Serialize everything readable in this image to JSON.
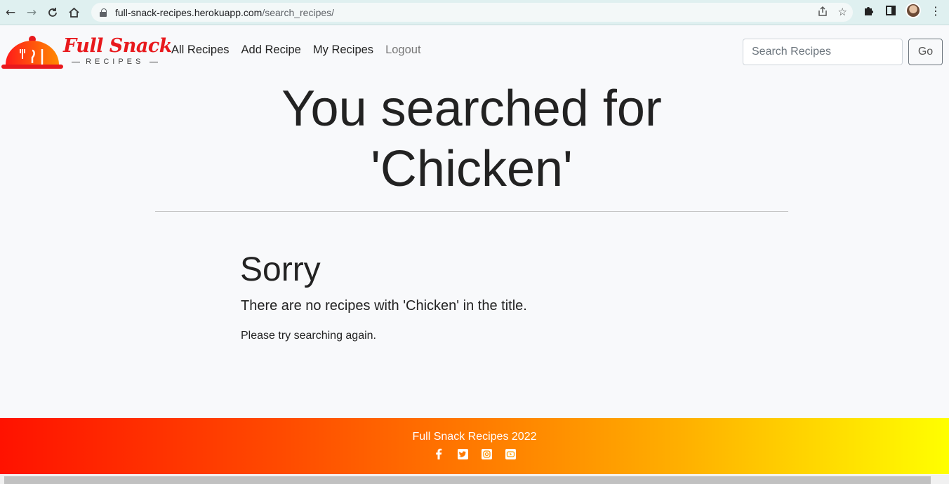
{
  "browser": {
    "url_host": "full-snack-recipes.herokuapp.com",
    "url_path": "/search_recipes/"
  },
  "navbar": {
    "logo_title": "Full Snack",
    "logo_subtitle": "RECIPES",
    "links": [
      {
        "label": "All Recipes"
      },
      {
        "label": "Add Recipe"
      },
      {
        "label": "My Recipes"
      },
      {
        "label": "Logout"
      }
    ],
    "search_placeholder": "Search Recipes",
    "go_label": "Go"
  },
  "main": {
    "headline_line1": "You searched for",
    "headline_line2": "'Chicken'",
    "sorry": "Sorry",
    "no_recipes": "There are no recipes with 'Chicken' in the title.",
    "try_again": "Please try searching again."
  },
  "footer": {
    "text": "Full Snack Recipes 2022",
    "icons": [
      "facebook-icon",
      "twitter-icon",
      "instagram-icon",
      "youtube-icon"
    ]
  },
  "colors": {
    "brand_red": "#e8191d",
    "footer_start": "#ff1200",
    "footer_end": "#ffff00"
  }
}
